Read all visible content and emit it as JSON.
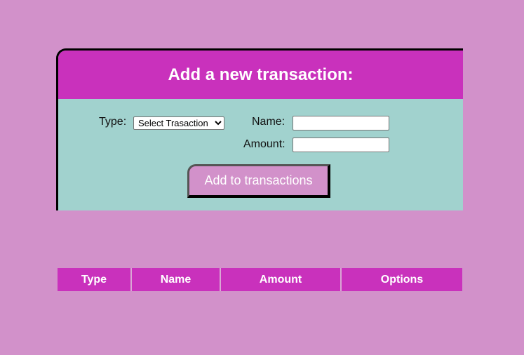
{
  "form": {
    "title": "Add a new transaction:",
    "type_label": "Type:",
    "type_select": {
      "selected": "Select Trasaction",
      "options": [
        "Select Trasaction"
      ]
    },
    "name_label": "Name:",
    "name_value": "",
    "amount_label": "Amount:",
    "amount_value": "",
    "submit_label": "Add to transactions"
  },
  "table": {
    "headers": [
      "Type",
      "Name",
      "Amount",
      "Options"
    ],
    "rows": []
  },
  "colors": {
    "page_background": "#d291ca",
    "header_magenta": "#c931bc",
    "form_teal": "#a1d2ce",
    "button_pink": "#d291ca"
  }
}
